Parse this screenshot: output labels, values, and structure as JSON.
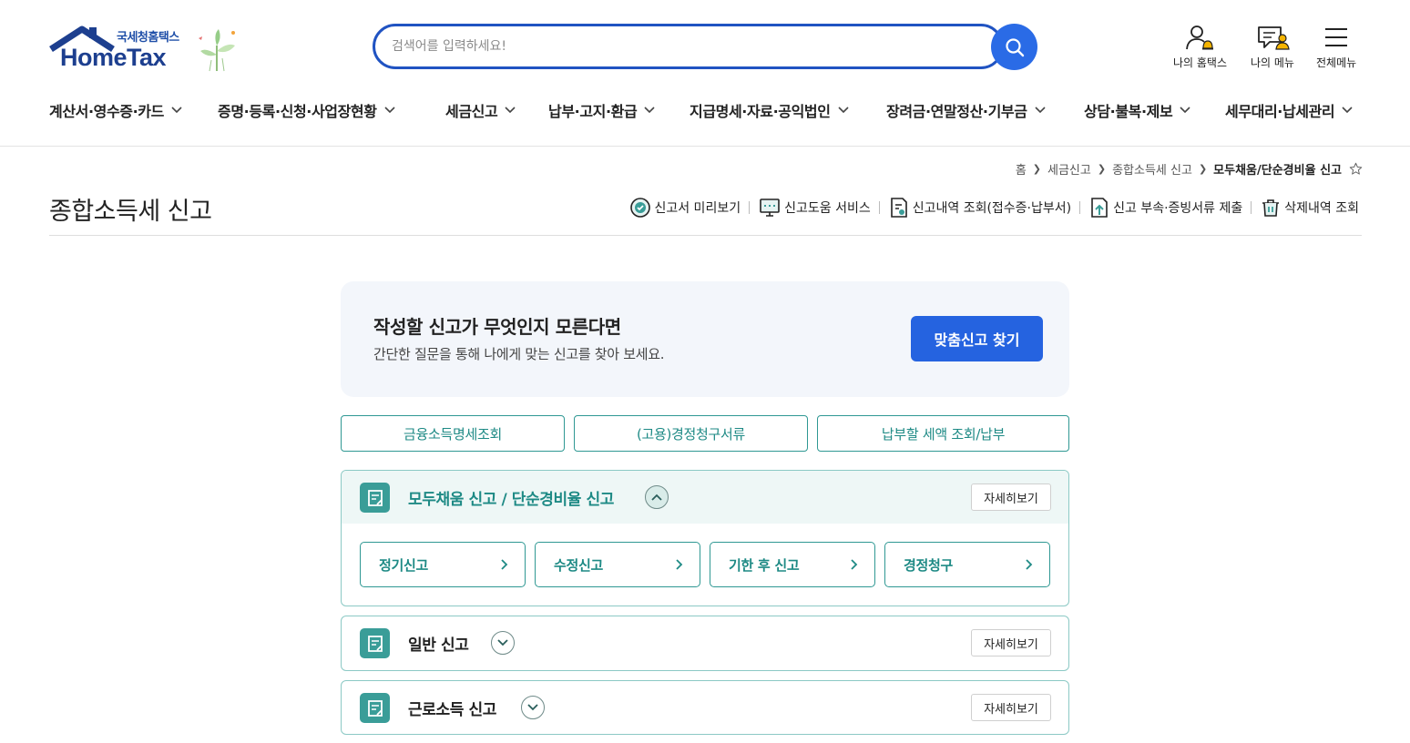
{
  "logo": {
    "subtitle": "국세청홈택스",
    "name": "HomeTax"
  },
  "search": {
    "placeholder": "검색어를 입력하세요!"
  },
  "header_icons": [
    {
      "label": "나의 홈택스",
      "icon": "user-bell-icon"
    },
    {
      "label": "나의 메뉴",
      "icon": "document-user-icon"
    },
    {
      "label": "전체메뉴",
      "icon": "hamburger-menu-icon"
    }
  ],
  "nav": [
    "계산서·영수증·카드",
    "증명·등록·신청·사업장현황",
    "세금신고",
    "납부·고지·환급",
    "지급명세·자료·공익법인",
    "장려금·연말정산·기부금",
    "상담·불복·제보",
    "세무대리·납세관리"
  ],
  "breadcrumb": [
    "홈",
    "세금신고",
    "종합소득세 신고",
    "모두채움/단순경비율 신고"
  ],
  "page_title": "종합소득세 신고",
  "tools": [
    {
      "label": "신고서 미리보기",
      "icon": "check-circle-icon"
    },
    {
      "label": "신고도움 서비스",
      "icon": "monitor-help-icon"
    },
    {
      "label": "신고내역 조회(접수증·납부서)",
      "icon": "document-search-icon"
    },
    {
      "label": "신고 부속·증빙서류 제출",
      "icon": "document-upload-icon"
    },
    {
      "label": "삭제내역 조회",
      "icon": "trash-icon"
    }
  ],
  "banner": {
    "title": "작성할 신고가 무엇인지 모른다면",
    "subtitle": "간단한 질문을 통해 나에게 맞는 신고를 찾아 보세요.",
    "button": "맞춤신고 찾기"
  },
  "quick_buttons": [
    "금융소득명세조회",
    "(고용)경정청구서류",
    "납부할 세액 조회/납부"
  ],
  "accordions": [
    {
      "title": "모두채움 신고 / 단순경비율 신고",
      "expanded": true,
      "detail": "자세히보기",
      "items": [
        "정기신고",
        "수정신고",
        "기한 후 신고",
        "경정청구"
      ]
    },
    {
      "title": "일반 신고",
      "expanded": false,
      "detail": "자세히보기"
    },
    {
      "title": "근로소득 신고",
      "expanded": false,
      "detail": "자세히보기"
    }
  ],
  "colors": {
    "primary_blue": "#2563e0",
    "teal": "#2f9893",
    "navy": "#1d3f8f"
  }
}
